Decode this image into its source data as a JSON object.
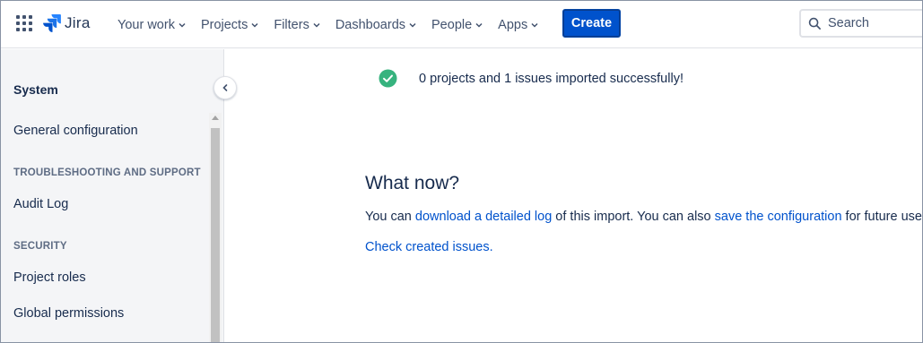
{
  "topnav": {
    "logo_text": "Jira",
    "items": [
      {
        "label": "Your work"
      },
      {
        "label": "Projects"
      },
      {
        "label": "Filters"
      },
      {
        "label": "Dashboards"
      },
      {
        "label": "People"
      },
      {
        "label": "Apps"
      }
    ],
    "create_label": "Create",
    "search_placeholder": "Search"
  },
  "sidebar": {
    "title": "System",
    "general_configuration": "General configuration",
    "troubleshooting_heading": "TROUBLESHOOTING AND SUPPORT",
    "audit_log": "Audit Log",
    "security_heading": "SECURITY",
    "project_roles": "Project roles",
    "global_permissions": "Global permissions"
  },
  "main": {
    "success_message": "0 projects and 1 issues imported successfully!",
    "heading": "What now?",
    "line1_prefix": "You can ",
    "link_download": "download a detailed log",
    "line1_middle": " of this import. You can also ",
    "link_save": "save the configuration",
    "line1_suffix": " for future use.",
    "link_check": "Check created issues",
    "line2_suffix": "."
  },
  "colors": {
    "primary": "#0052cc",
    "success": "#36b37e",
    "text": "#172b4d",
    "sidebar_bg": "#f4f5f7"
  }
}
